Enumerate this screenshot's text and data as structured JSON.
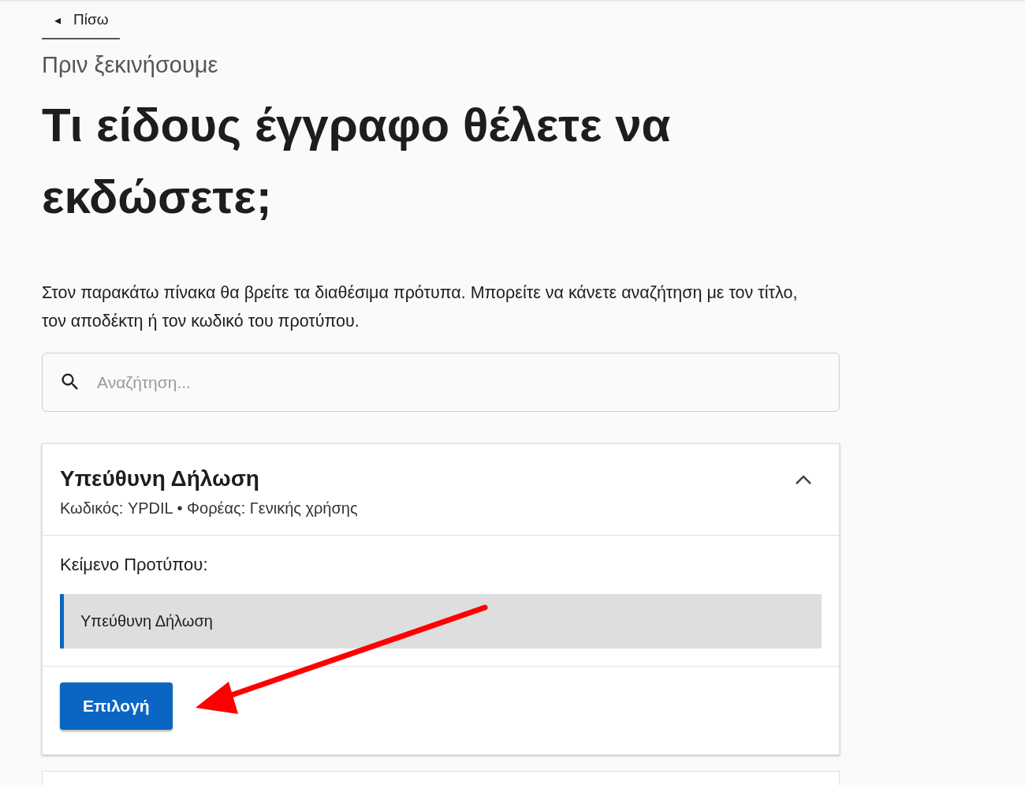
{
  "back_link": {
    "icon": "◂",
    "label": "Πίσω"
  },
  "subtitle": "Πριν ξεκινήσουμε",
  "title": "Τι είδους έγγραφο θέλετε να εκδώσετε;",
  "intro": "Στον παρακάτω πίνακα θα βρείτε τα διαθέσιμα πρότυπα. Μπορείτε να κάνετε αναζήτηση με τον τίτλο, τον αποδέκτη ή τον κωδικό του προτύπου.",
  "search": {
    "placeholder": "Αναζήτηση..."
  },
  "templates": [
    {
      "name": "Υπεύθυνη Δήλωση",
      "meta": "Κωδικός: YPDIL • Φορέας: Γενικής χρήσης",
      "expanded": true,
      "text_label": "Κείμενο Προτύπου:",
      "text": "Υπεύθυνη Δήλωση",
      "button": "Επιλογή"
    }
  ],
  "annotation": {
    "kind": "arrow",
    "color": "#ff0000"
  }
}
